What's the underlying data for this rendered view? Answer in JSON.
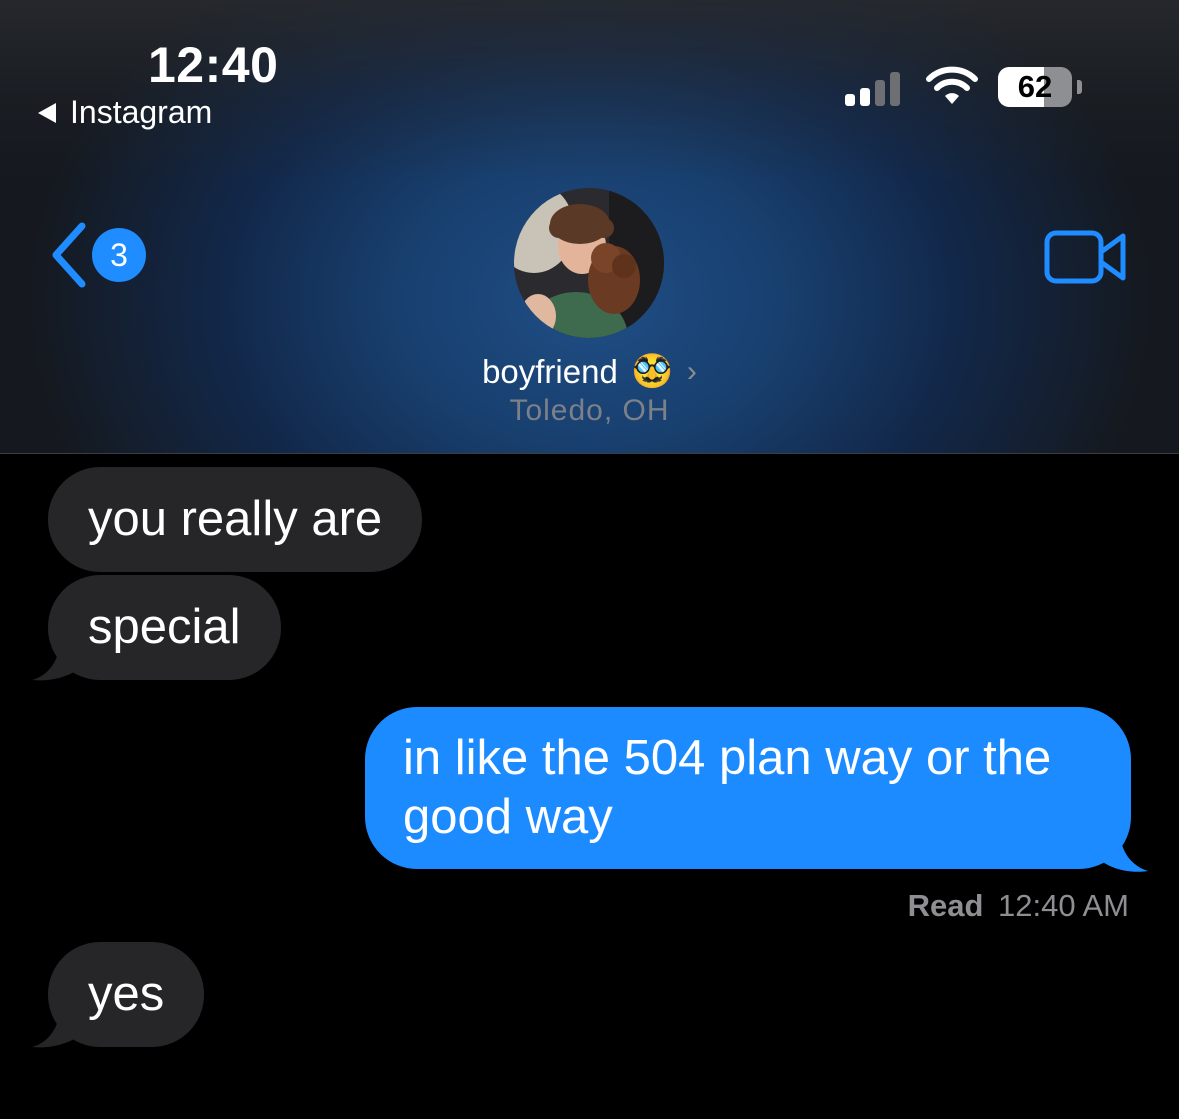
{
  "status_bar": {
    "time": "12:40",
    "back_app": "Instagram",
    "battery": "62"
  },
  "nav": {
    "unread_count": "3"
  },
  "contact": {
    "name": "boyfriend",
    "emoji": "🥸",
    "location": "Toledo, OH"
  },
  "messages": [
    {
      "direction": "incoming",
      "text": "you really are"
    },
    {
      "direction": "incoming",
      "text": "special"
    },
    {
      "direction": "outgoing",
      "text": "in like the 504 plan way or the good way"
    },
    {
      "direction": "incoming",
      "text": "yes"
    }
  ],
  "receipt": {
    "label": "Read",
    "time": "12:40 AM"
  },
  "colors": {
    "accent": "#1f8cff",
    "outgoing_bubble": "#1b8bff",
    "incoming_bubble": "#262628",
    "background": "#000000"
  }
}
